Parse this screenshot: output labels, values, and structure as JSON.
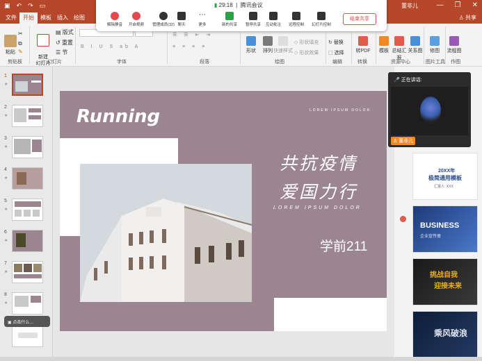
{
  "titlebar": {
    "user": "董非儿",
    "minimize": "—",
    "restore": "❐",
    "close": "✕"
  },
  "tabs": [
    {
      "label": "文件"
    },
    {
      "label": "开始"
    },
    {
      "label": "模板"
    },
    {
      "label": "插入"
    },
    {
      "label": "绘图"
    }
  ],
  "share_label": "共享",
  "ribbon": {
    "paste": "粘贴",
    "new_slide": "新建\n幻灯片",
    "layout": "版式",
    "reset": "重置",
    "section": "节",
    "groups": {
      "clipboard": "剪贴板",
      "slides": "幻灯片",
      "font": "字体",
      "paragraph": "段落",
      "drawing": "绘图",
      "editing": "编辑",
      "convert": "转换",
      "resources": "资源中心",
      "image_tools": "图片工具",
      "works": "作图"
    },
    "shapes": "形状",
    "arrange": "排列",
    "quick_styles": "快速样式",
    "shape_fill": "形状填充",
    "shape_effects": "形状效果",
    "replace": "替换",
    "select": "选择",
    "to_pdf": "转PDF",
    "template": "模板",
    "summary": "总结汇报",
    "relation": "关系图",
    "edit_img": "修图",
    "flowchart": "流程图"
  },
  "meeting": {
    "time": "29:18",
    "app": "腾讯会议",
    "buttons": [
      {
        "label": "解除静音",
        "icon": "mic-muted-icon"
      },
      {
        "label": "开启视频",
        "icon": "camera-off-icon"
      },
      {
        "label": "管理成员(32)",
        "icon": "members-icon"
      },
      {
        "label": "聊天",
        "icon": "chat-icon"
      },
      {
        "label": "更多",
        "icon": "more-icon"
      },
      {
        "label": "新的共享",
        "icon": "new-share-icon"
      },
      {
        "label": "暂停共享",
        "icon": "pause-share-icon"
      },
      {
        "label": "互动批注",
        "icon": "annotate-icon"
      },
      {
        "label": "远程控制",
        "icon": "remote-icon"
      },
      {
        "label": "幻灯片控制",
        "icon": "slide-control-icon"
      }
    ],
    "end_share": "结束共享"
  },
  "thumbnails": [
    {
      "num": "1"
    },
    {
      "num": "2"
    },
    {
      "num": "3"
    },
    {
      "num": "4"
    },
    {
      "num": "5"
    },
    {
      "num": "6"
    },
    {
      "num": "7"
    },
    {
      "num": "8"
    }
  ],
  "toast": "点击什么…",
  "slide": {
    "title_en": "Running",
    "lorem_top": "LOREM IPSUM DOLOR",
    "cn_line1": "共抗疫情",
    "cn_line2": "爱国力行",
    "lorem_mid": "LOREM IPSUM DOLOR",
    "course": "学前211"
  },
  "speaker": {
    "header": "正在讲话:",
    "name": "董非儿"
  },
  "templates": [
    {
      "title": "20XX年",
      "subtitle": "极简通用模板",
      "note": "汇报人: XXX"
    },
    {
      "title": "BUSINESS",
      "subtitle": "企业宣传册"
    },
    {
      "title": "挑战自我",
      "subtitle": "迎接未来"
    },
    {
      "title": "乘风破浪"
    }
  ],
  "colors": {
    "accent": "#b7472a",
    "slide_bg": "#9b8590"
  }
}
